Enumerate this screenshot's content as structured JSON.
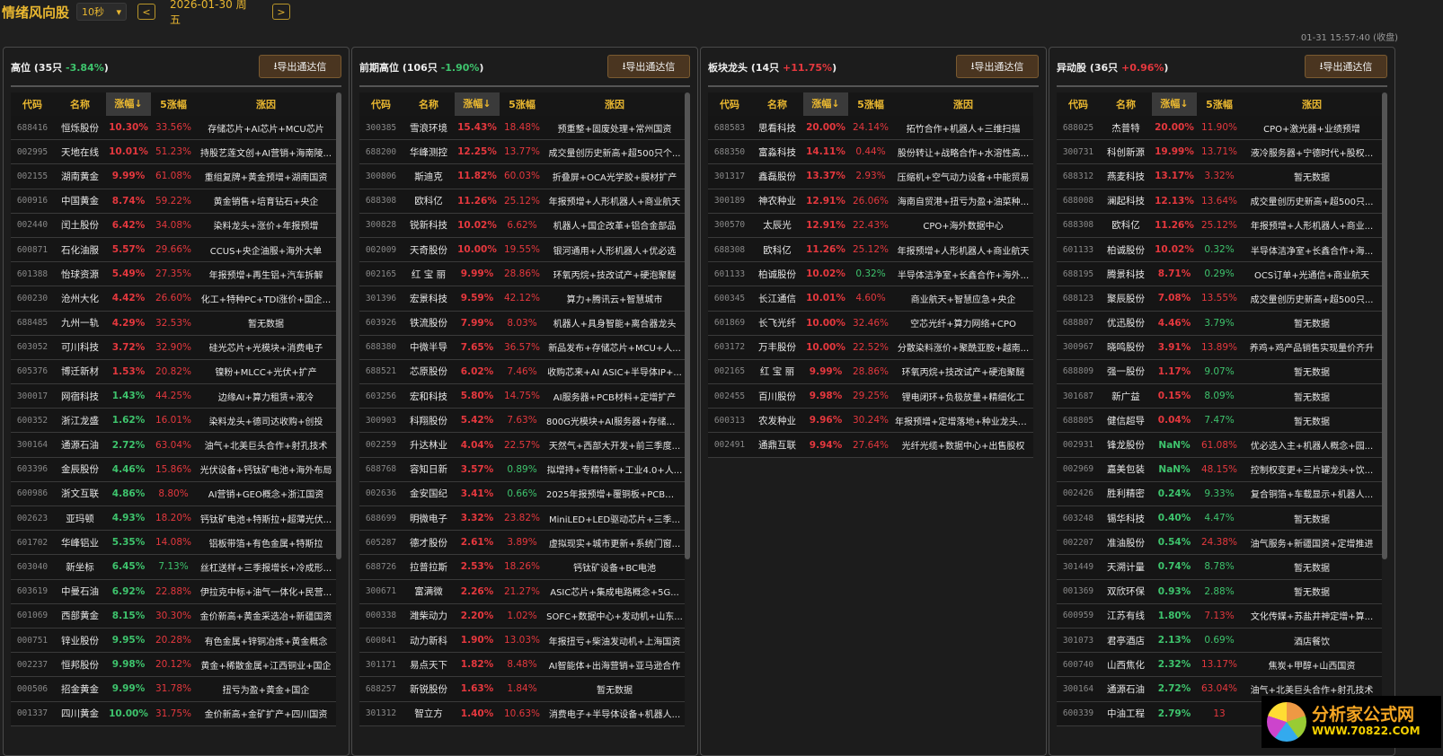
{
  "app": {
    "title": "情绪风向股",
    "interval": "10秒",
    "prev": "<",
    "next": ">",
    "date": "2026-01-30 周五",
    "status": "01-31 15:57:40 (收盘)"
  },
  "colors": {
    "up": "#e5383e",
    "down": "#3ec46d",
    "accent": "#e9b730"
  },
  "columns": [
    "代码",
    "名称",
    "涨幅↓",
    "5涨幅",
    "涨因"
  ],
  "export_label": "导出通达信",
  "logo": {
    "line1": "分析家公式网",
    "line2": "WWW.70822.COM"
  },
  "panels": [
    {
      "name": "高位",
      "count": "(35只",
      "pct": "-3.84%",
      "pct_dir": "dn",
      "close": ")",
      "rows": [
        [
          "688416",
          "恒烁股份",
          "10.30%",
          "up",
          "33.56%",
          "up",
          "存储芯片+AI芯片+MCU芯片"
        ],
        [
          "002995",
          "天地在线",
          "10.01%",
          "up",
          "51.23%",
          "up",
          "持股艺莲文创+AI营销+海南陵..."
        ],
        [
          "002155",
          "湖南黄金",
          "9.99%",
          "up",
          "61.08%",
          "up",
          "重组复牌+黄金预增+湖南国资"
        ],
        [
          "600916",
          "中国黄金",
          "8.74%",
          "up",
          "59.22%",
          "up",
          "黄金销售+培育钻石+央企"
        ],
        [
          "002440",
          "闰土股份",
          "6.42%",
          "up",
          "34.08%",
          "up",
          "染料龙头+涨价+年报预增"
        ],
        [
          "600871",
          "石化油服",
          "5.57%",
          "up",
          "29.66%",
          "up",
          "CCUS+央企油服+海外大单"
        ],
        [
          "601388",
          "怡球资源",
          "5.49%",
          "up",
          "27.35%",
          "up",
          "年报预增+再生铝+汽车拆解"
        ],
        [
          "600230",
          "沧州大化",
          "4.42%",
          "up",
          "26.60%",
          "up",
          "化工+特种PC+TDI涨价+国企..."
        ],
        [
          "688485",
          "九州一轨",
          "4.29%",
          "up",
          "32.53%",
          "up",
          "暂无数据"
        ],
        [
          "603052",
          "可川科技",
          "3.72%",
          "up",
          "32.90%",
          "up",
          "硅光芯片+光模块+消费电子"
        ],
        [
          "605376",
          "博迁新材",
          "1.53%",
          "up",
          "20.82%",
          "up",
          "镍粉+MLCC+光伏+扩产"
        ],
        [
          "300017",
          "网宿科技",
          "1.43%",
          "dn",
          "44.25%",
          "up",
          "边缘AI+算力租赁+液冷"
        ],
        [
          "600352",
          "浙江龙盛",
          "1.62%",
          "dn",
          "16.01%",
          "up",
          "染料龙头+德司达收购+创投"
        ],
        [
          "300164",
          "通源石油",
          "2.72%",
          "dn",
          "63.04%",
          "up",
          "油气+北美巨头合作+射孔技术"
        ],
        [
          "603396",
          "金辰股份",
          "4.46%",
          "dn",
          "15.86%",
          "up",
          "光伏设备+钙钛矿电池+海外布局"
        ],
        [
          "600986",
          "浙文互联",
          "4.86%",
          "dn",
          "8.80%",
          "up",
          "AI营销+GEO概念+浙江国资"
        ],
        [
          "002623",
          "亚玛顿",
          "4.93%",
          "dn",
          "18.20%",
          "up",
          "钙钛矿电池+特斯拉+超薄光伏..."
        ],
        [
          "601702",
          "华峰铝业",
          "5.35%",
          "dn",
          "14.08%",
          "up",
          "铝板带箔+有色金属+特斯拉"
        ],
        [
          "603040",
          "新坐标",
          "6.45%",
          "dn",
          "7.13%",
          "dn",
          "丝杠送样+三季报增长+冷成形..."
        ],
        [
          "603619",
          "中曼石油",
          "6.92%",
          "dn",
          "22.88%",
          "up",
          "伊拉克中标+油气一体化+民营..."
        ],
        [
          "601069",
          "西部黄金",
          "8.15%",
          "dn",
          "30.30%",
          "up",
          "金价新高+黄金采选冶+新疆国资"
        ],
        [
          "000751",
          "锌业股份",
          "9.95%",
          "dn",
          "20.28%",
          "up",
          "有色金属+锌铜冶炼+黄金概念"
        ],
        [
          "002237",
          "恒邦股份",
          "9.98%",
          "dn",
          "20.12%",
          "up",
          "黄金+稀散金属+江西铜业+国企"
        ],
        [
          "000506",
          "招金黄金",
          "9.99%",
          "dn",
          "31.78%",
          "up",
          "扭亏为盈+黄金+国企"
        ],
        [
          "001337",
          "四川黄金",
          "10.00%",
          "dn",
          "31.75%",
          "up",
          "金价新高+金矿扩产+四川国资"
        ]
      ]
    },
    {
      "name": "前期高位",
      "count": "(106只",
      "pct": "-1.90%",
      "pct_dir": "dn",
      "close": ")",
      "rows": [
        [
          "300385",
          "雪浪环境",
          "15.43%",
          "up",
          "18.48%",
          "up",
          "预重整+固废处理+常州国资"
        ],
        [
          "688200",
          "华峰测控",
          "12.25%",
          "up",
          "13.77%",
          "up",
          "成交量创历史新高+超500只个..."
        ],
        [
          "300806",
          "斯迪克",
          "11.82%",
          "up",
          "60.03%",
          "up",
          "折叠屏+OCA光学胶+膜材扩产"
        ],
        [
          "688308",
          "欧科亿",
          "11.26%",
          "up",
          "25.12%",
          "up",
          "年报预增+人形机器人+商业航天"
        ],
        [
          "300828",
          "锐新科技",
          "10.02%",
          "up",
          "6.62%",
          "up",
          "机器人+国企改革+铝合金部品"
        ],
        [
          "002009",
          "天奇股份",
          "10.00%",
          "up",
          "19.55%",
          "up",
          "银河通用+人形机器人+优必选"
        ],
        [
          "002165",
          "红 宝 丽",
          "9.99%",
          "up",
          "28.86%",
          "up",
          "环氧丙烷+技改试产+硬泡聚醚"
        ],
        [
          "301396",
          "宏景科技",
          "9.59%",
          "up",
          "42.12%",
          "up",
          "算力+腾讯云+智慧城市"
        ],
        [
          "603926",
          "铁流股份",
          "7.99%",
          "up",
          "8.03%",
          "up",
          "机器人+具身智能+离合器龙头"
        ],
        [
          "688380",
          "中微半导",
          "7.65%",
          "up",
          "36.57%",
          "up",
          "新品发布+存储芯片+MCU+人..."
        ],
        [
          "688521",
          "芯原股份",
          "6.02%",
          "up",
          "7.46%",
          "up",
          "收购芯来+AI ASIC+半导体IP+..."
        ],
        [
          "603256",
          "宏和科技",
          "5.80%",
          "up",
          "14.75%",
          "up",
          "AI服务器+PCB材料+定增扩产"
        ],
        [
          "300903",
          "科翔股份",
          "5.42%",
          "up",
          "7.63%",
          "up",
          "800G光模块+AI服务器+存储芯..."
        ],
        [
          "002259",
          "升达林业",
          "4.04%",
          "up",
          "22.57%",
          "up",
          "天然气+西部大开发+前三季度..."
        ],
        [
          "688768",
          "容知日新",
          "3.57%",
          "up",
          "0.89%",
          "dn",
          "拟增持+专精特新+工业4.0+人..."
        ],
        [
          "002636",
          "金安国纪",
          "3.41%",
          "up",
          "0.66%",
          "dn",
          "2025年报预增+覆铜板+PCB概念"
        ],
        [
          "688699",
          "明微电子",
          "3.32%",
          "up",
          "23.82%",
          "up",
          "MiniLED+LED驱动芯片+三季..."
        ],
        [
          "605287",
          "德才股份",
          "2.61%",
          "up",
          "3.89%",
          "up",
          "虚拟现实+城市更新+系统门窗..."
        ],
        [
          "688726",
          "拉普拉斯",
          "2.53%",
          "up",
          "18.26%",
          "up",
          "钙钛矿设备+BC电池"
        ],
        [
          "300671",
          "富满微",
          "2.26%",
          "up",
          "21.27%",
          "up",
          "ASIC芯片+集成电路概念+5G..."
        ],
        [
          "000338",
          "潍柴动力",
          "2.20%",
          "up",
          "1.02%",
          "up",
          "SOFC+数据中心+发动机+山东..."
        ],
        [
          "600841",
          "动力新科",
          "1.90%",
          "up",
          "13.03%",
          "up",
          "年报扭亏+柴油发动机+上海国资"
        ],
        [
          "301171",
          "易点天下",
          "1.82%",
          "up",
          "8.48%",
          "up",
          "AI智能体+出海营销+亚马逊合作"
        ],
        [
          "688257",
          "新锐股份",
          "1.63%",
          "up",
          "1.84%",
          "up",
          "暂无数据"
        ],
        [
          "301312",
          "智立方",
          "1.40%",
          "up",
          "10.63%",
          "up",
          "消费电子+半导体设备+机器人..."
        ]
      ]
    },
    {
      "name": "板块龙头",
      "count": "(14只",
      "pct": "+11.75%",
      "pct_dir": "up",
      "close": ")",
      "rows": [
        [
          "688583",
          "思看科技",
          "20.00%",
          "up",
          "24.14%",
          "up",
          "拓竹合作+机器人+三维扫描"
        ],
        [
          "688350",
          "富淼科技",
          "14.11%",
          "up",
          "0.44%",
          "up",
          "股份转让+战略合作+水溶性高..."
        ],
        [
          "301317",
          "鑫磊股份",
          "13.37%",
          "up",
          "2.93%",
          "up",
          "压缩机+空气动力设备+中能贸易"
        ],
        [
          "300189",
          "神农种业",
          "12.91%",
          "up",
          "26.06%",
          "up",
          "海南自贸港+扭亏为盈+油菜种..."
        ],
        [
          "300570",
          "太辰光",
          "12.91%",
          "up",
          "22.43%",
          "up",
          "CPO+海外数据中心"
        ],
        [
          "688308",
          "欧科亿",
          "11.26%",
          "up",
          "25.12%",
          "up",
          "年报预增+人形机器人+商业航天"
        ],
        [
          "601133",
          "柏诚股份",
          "10.02%",
          "up",
          "0.32%",
          "dn",
          "半导体洁净室+长鑫合作+海外..."
        ],
        [
          "600345",
          "长江通信",
          "10.01%",
          "up",
          "4.60%",
          "up",
          "商业航天+智慧应急+央企"
        ],
        [
          "601869",
          "长飞光纤",
          "10.00%",
          "up",
          "32.46%",
          "up",
          "空芯光纤+算力网络+CPO"
        ],
        [
          "603172",
          "万丰股份",
          "10.00%",
          "up",
          "22.52%",
          "up",
          "分散染料涨价+聚酰亚胺+越南..."
        ],
        [
          "002165",
          "红 宝 丽",
          "9.99%",
          "up",
          "28.86%",
          "up",
          "环氧丙烷+技改试产+硬泡聚醚"
        ],
        [
          "002455",
          "百川股份",
          "9.98%",
          "up",
          "29.25%",
          "up",
          "锂电闭环+负极放量+精细化工"
        ],
        [
          "600313",
          "农发种业",
          "9.96%",
          "up",
          "30.24%",
          "up",
          "年报预增+定增落地+种业龙头+..."
        ],
        [
          "002491",
          "通鼎互联",
          "9.94%",
          "up",
          "27.64%",
          "up",
          "光纤光缆+数据中心+出售股权"
        ]
      ]
    },
    {
      "name": "异动股",
      "count": "(36只",
      "pct": "+0.96%",
      "pct_dir": "up",
      "close": ")",
      "rows": [
        [
          "688025",
          "杰普特",
          "20.00%",
          "up",
          "11.90%",
          "up",
          "CPO+激光器+业绩预增"
        ],
        [
          "300731",
          "科创新源",
          "19.99%",
          "up",
          "13.71%",
          "up",
          "液冷服务器+宁德时代+股权..."
        ],
        [
          "688312",
          "燕麦科技",
          "13.17%",
          "up",
          "3.32%",
          "up",
          "暂无数据"
        ],
        [
          "688008",
          "澜起科技",
          "12.13%",
          "up",
          "13.64%",
          "up",
          "成交量创历史新高+超500只..."
        ],
        [
          "688308",
          "欧科亿",
          "11.26%",
          "up",
          "25.12%",
          "up",
          "年报预增+人形机器人+商业..."
        ],
        [
          "601133",
          "柏诚股份",
          "10.02%",
          "up",
          "0.32%",
          "dn",
          "半导体洁净室+长鑫合作+海..."
        ],
        [
          "688195",
          "腾景科技",
          "8.71%",
          "up",
          "0.29%",
          "dn",
          "OCS订单+光通信+商业航天"
        ],
        [
          "688123",
          "聚辰股份",
          "7.08%",
          "up",
          "13.55%",
          "up",
          "成交量创历史新高+超500只..."
        ],
        [
          "688807",
          "优迅股份",
          "4.46%",
          "up",
          "3.79%",
          "dn",
          "暂无数据"
        ],
        [
          "300967",
          "晓鸣股份",
          "3.91%",
          "up",
          "13.89%",
          "up",
          "养鸡+鸡产品销售实现量价齐升"
        ],
        [
          "688809",
          "强一股份",
          "1.17%",
          "up",
          "9.07%",
          "dn",
          "暂无数据"
        ],
        [
          "301687",
          "新广益",
          "0.15%",
          "up",
          "8.09%",
          "dn",
          "暂无数据"
        ],
        [
          "688805",
          "健信超导",
          "0.04%",
          "up",
          "7.47%",
          "dn",
          "暂无数据"
        ],
        [
          "002931",
          "锋龙股份",
          "NaN%",
          "dn",
          "61.08%",
          "up",
          "优必选入主+机器人概念+园..."
        ],
        [
          "002969",
          "嘉美包装",
          "NaN%",
          "dn",
          "48.15%",
          "up",
          "控制权变更+三片罐龙头+饮..."
        ],
        [
          "002426",
          "胜利精密",
          "0.24%",
          "dn",
          "9.33%",
          "dn",
          "复合铜箔+车载显示+机器人..."
        ],
        [
          "603248",
          "锡华科技",
          "0.40%",
          "dn",
          "4.47%",
          "dn",
          "暂无数据"
        ],
        [
          "002207",
          "准油股份",
          "0.54%",
          "dn",
          "24.38%",
          "up",
          "油气服务+新疆国资+定增推进"
        ],
        [
          "301449",
          "天溯计量",
          "0.74%",
          "dn",
          "8.78%",
          "dn",
          "暂无数据"
        ],
        [
          "001369",
          "双欣环保",
          "0.93%",
          "dn",
          "2.88%",
          "dn",
          "暂无数据"
        ],
        [
          "600959",
          "江苏有线",
          "1.80%",
          "dn",
          "7.13%",
          "up",
          "文化传媒+苏盐井神定增+算..."
        ],
        [
          "301073",
          "君亭酒店",
          "2.13%",
          "dn",
          "0.69%",
          "dn",
          "酒店餐饮"
        ],
        [
          "600740",
          "山西焦化",
          "2.32%",
          "dn",
          "13.17%",
          "up",
          "焦炭+甲醇+山西国资"
        ],
        [
          "300164",
          "通源石油",
          "2.72%",
          "dn",
          "63.04%",
          "up",
          "油气+北美巨头合作+射孔技术"
        ],
        [
          "600339",
          "中油工程",
          "2.79%",
          "dn",
          "13",
          "up",
          ""
        ]
      ]
    }
  ]
}
